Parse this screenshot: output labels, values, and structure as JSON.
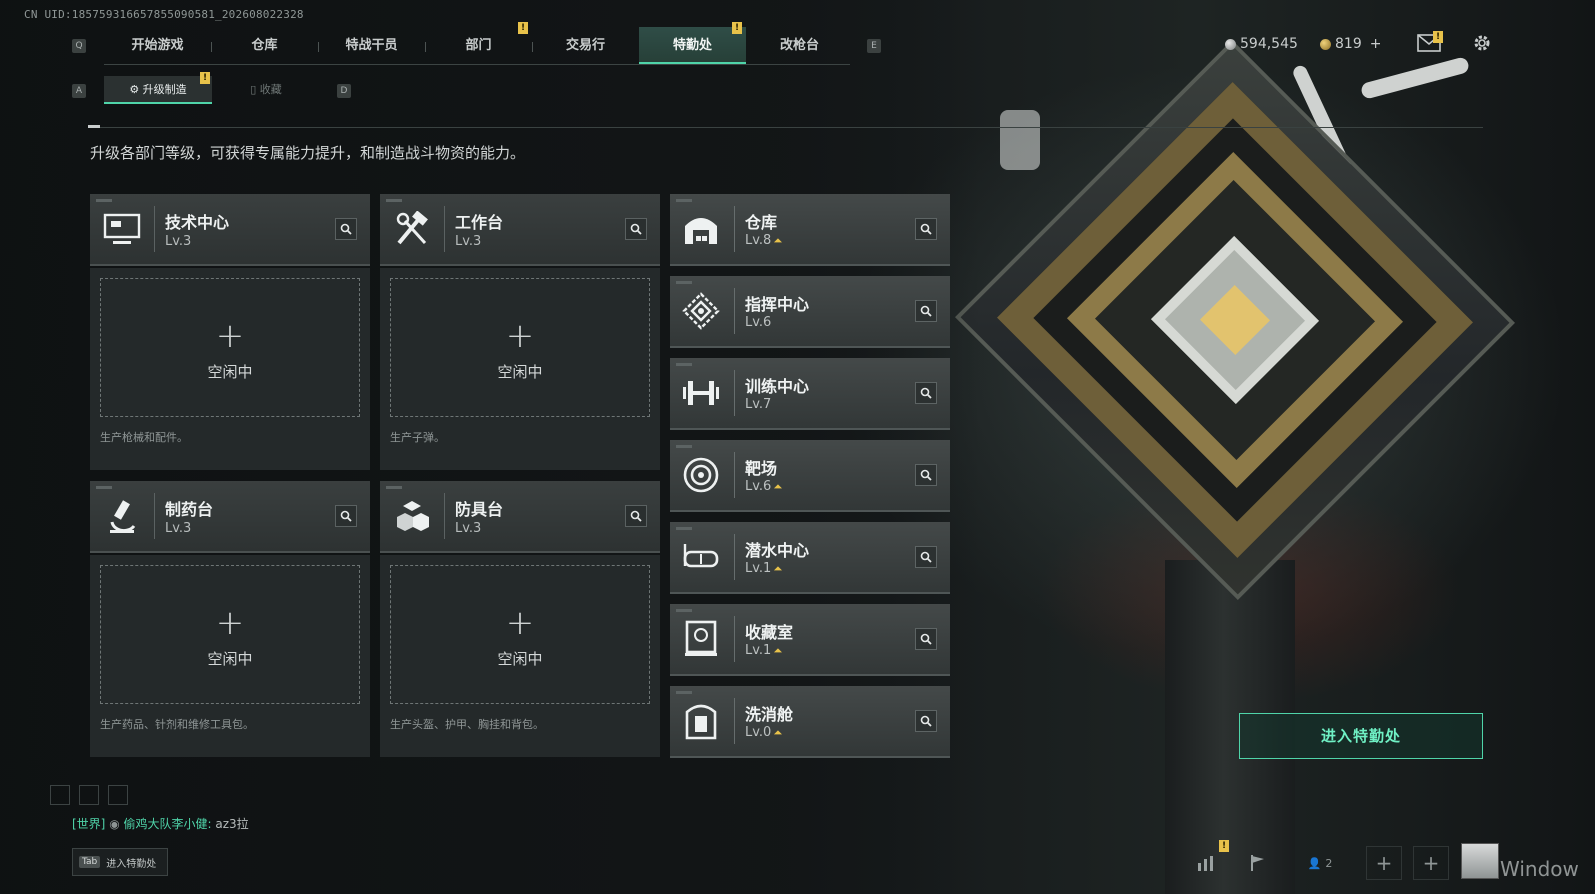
{
  "uid": "CN UID:1857593166578550905​81_202608022328",
  "nav": {
    "left_key": "Q",
    "right_key": "E",
    "items": [
      "开始游戏",
      "仓库",
      "特战干员",
      "部门",
      "交易行",
      "特勤处",
      "改枪台"
    ],
    "active": "特勤处"
  },
  "currency": {
    "silver": "594,545",
    "gold": "819",
    "plus": "+"
  },
  "subnav": {
    "left_key": "A",
    "right_key": "D",
    "items": [
      "升级制造",
      "收藏"
    ],
    "active": "升级制造"
  },
  "description": "升级各部门等级，可获得专属能力提升，和制造战斗物资的能力。",
  "production_cards": [
    {
      "name": "技术中心",
      "level": "Lv.3",
      "icon": "computer-icon",
      "slot_plus": "+",
      "slot_status": "空闲中",
      "note": "生产枪械和配件。"
    },
    {
      "name": "工作台",
      "level": "Lv.3",
      "icon": "hammer-wrench-icon",
      "slot_plus": "+",
      "slot_status": "空闲中",
      "note": "生产子弹。"
    },
    {
      "name": "制药台",
      "level": "Lv.3",
      "icon": "microscope-icon",
      "slot_plus": "+",
      "slot_status": "空闲中",
      "note": "生产药品、针剂和维修工具包。"
    },
    {
      "name": "防具台",
      "level": "Lv.3",
      "icon": "armor-blocks-icon",
      "slot_plus": "+",
      "slot_status": "空闲中",
      "note": "生产头盔、护甲、胸挂和背包。"
    }
  ],
  "departments": [
    {
      "name": "仓库",
      "level": "Lv.8",
      "upgradable": true,
      "icon": "warehouse-icon"
    },
    {
      "name": "指挥中心",
      "level": "Lv.6",
      "upgradable": false,
      "icon": "command-center-icon"
    },
    {
      "name": "训练中心",
      "level": "Lv.7",
      "upgradable": false,
      "icon": "dumbbell-icon"
    },
    {
      "name": "靶场",
      "level": "Lv.6",
      "upgradable": true,
      "icon": "target-icon"
    },
    {
      "name": "潜水中心",
      "level": "Lv.1",
      "upgradable": true,
      "icon": "diving-mask-icon"
    },
    {
      "name": "收藏室",
      "level": "Lv.1",
      "upgradable": true,
      "icon": "collection-room-icon"
    },
    {
      "name": "洗消舱",
      "level": "Lv.0",
      "upgradable": true,
      "icon": "decon-chamber-icon"
    }
  ],
  "enter_button": "进入特勤处",
  "chat": {
    "channel": "[世界]",
    "nick": "偷鸡大队李小健",
    "message": "az3拉"
  },
  "tab_hint": {
    "key": "Tab",
    "label": "进入特勤处"
  },
  "bottom": {
    "friends_count": "2",
    "watermark": "Window"
  },
  "colors": {
    "accent": "#4fd4a9",
    "badge": "#e8c24a",
    "panel": "#2d3232"
  }
}
